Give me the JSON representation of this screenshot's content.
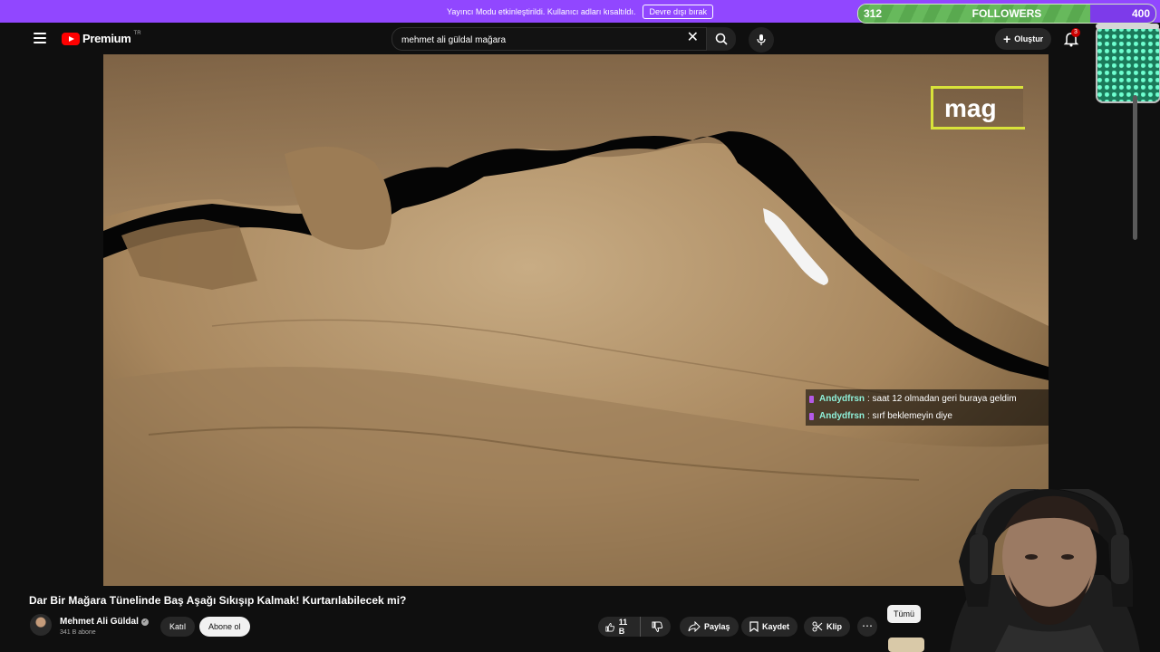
{
  "streamer_banner": {
    "message": "Yayıncı Modu etkinleştirildi. Kullanıcı adları kısaltıldı.",
    "button": "Devre dışı bırak"
  },
  "follower_goal": {
    "current": "312",
    "label": "FOLLOWERS",
    "target": "400",
    "progress": 0.78
  },
  "header": {
    "brand": "Premium",
    "region": "TR",
    "search_value": "mehmet ali güldal mağara",
    "create_label": "Oluştur",
    "notification_count": "3"
  },
  "video": {
    "overlay_label": "mag"
  },
  "chat": [
    {
      "user": "Andydfrsn",
      "message": ": saat 12 olmadan geri buraya geldim"
    },
    {
      "user": "Andydfrsn",
      "message": ": sırf beklemeyin diye"
    }
  ],
  "video_info": {
    "title": "Dar Bir Mağara Tünelinde Baş Aşağı Sıkışıp Kalmak! Kurtarılabilecek mi?",
    "channel": "Mehmet Ali Güldal",
    "subscribers": "341 B abone",
    "join_label": "Katıl",
    "subscribe_label": "Abone ol",
    "likes": "11 B",
    "share_label": "Paylaş",
    "save_label": "Kaydet",
    "clip_label": "Klip"
  },
  "chips": {
    "all": "Tümü"
  },
  "colors": {
    "banner": "#9147ff",
    "goal_fill": "#59a94f",
    "chat_user": "#8ff0d9",
    "highlight_box": "#d8e23a"
  }
}
